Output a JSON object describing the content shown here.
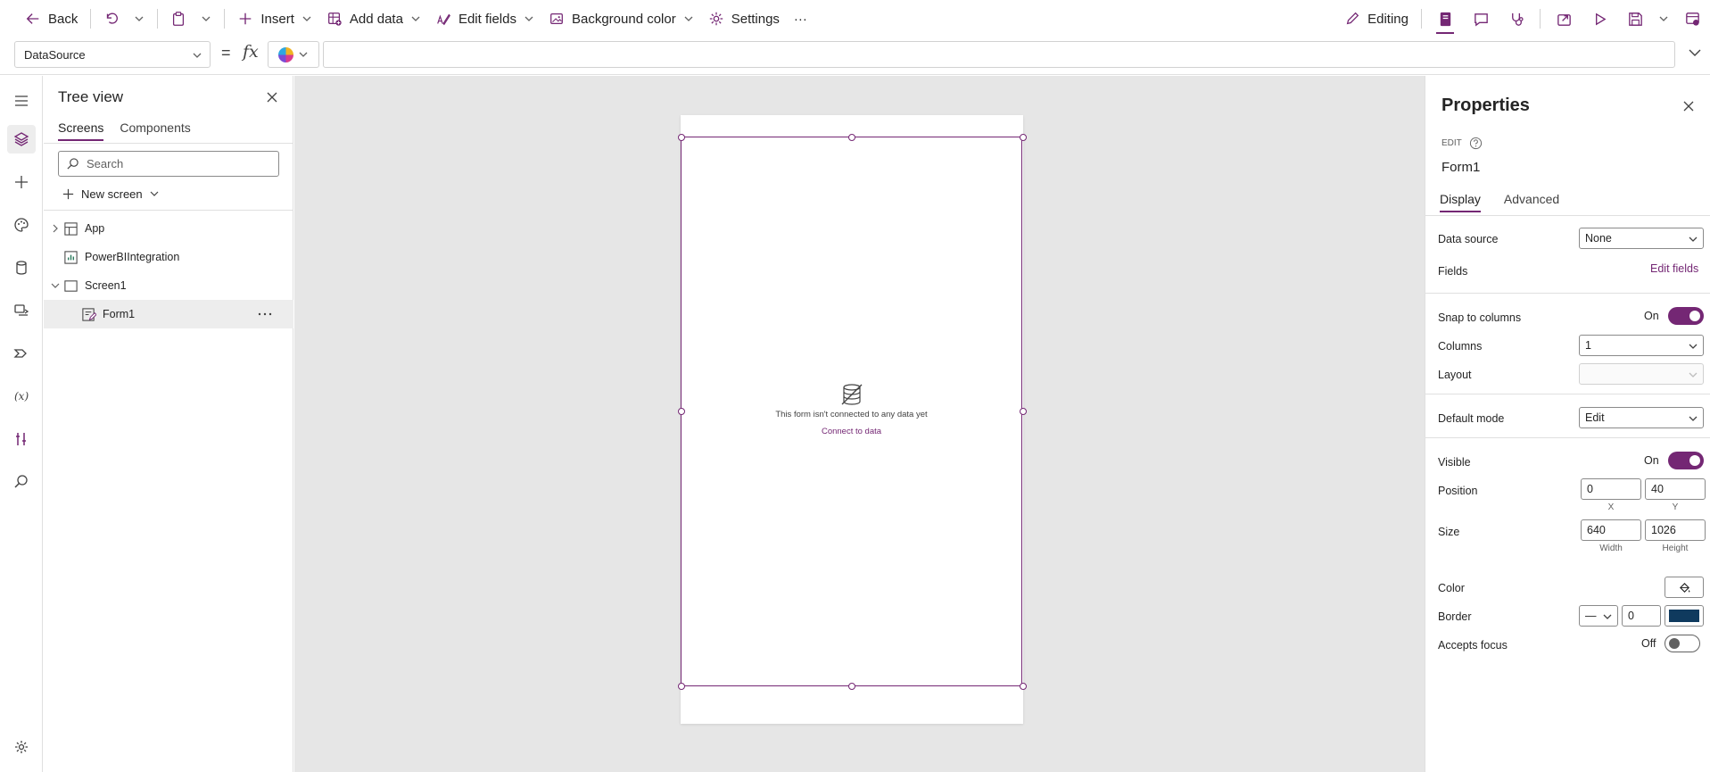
{
  "toolbar": {
    "back": "Back",
    "insert": "Insert",
    "add_data": "Add data",
    "edit_fields": "Edit fields",
    "background_color": "Background color",
    "settings": "Settings",
    "more": "···",
    "editing": "Editing"
  },
  "formula": {
    "property": "DataSource",
    "equals": "=",
    "fx": "fx",
    "value": ""
  },
  "tree": {
    "title": "Tree view",
    "tabs": [
      "Screens",
      "Components"
    ],
    "search_placeholder": "Search",
    "new_screen": "New screen",
    "items": [
      {
        "label": "App",
        "icon": "app-icon"
      },
      {
        "label": "PowerBIIntegration",
        "icon": "powerbi-integration-icon"
      },
      {
        "label": "Screen1",
        "icon": "screen-icon"
      },
      {
        "label": "Form1",
        "icon": "form-icon"
      }
    ]
  },
  "canvas": {
    "message": "This form isn't connected to any data yet",
    "link": "Connect to data"
  },
  "properties": {
    "title": "Properties",
    "edit_label": "EDIT",
    "control_name": "Form1",
    "tabs": [
      "Display",
      "Advanced"
    ],
    "data_source": {
      "label": "Data source",
      "value": "None"
    },
    "fields": {
      "label": "Fields",
      "link": "Edit fields"
    },
    "snap": {
      "label": "Snap to columns",
      "state": "On"
    },
    "columns": {
      "label": "Columns",
      "value": "1"
    },
    "layout": {
      "label": "Layout",
      "value": ""
    },
    "default_mode": {
      "label": "Default mode",
      "value": "Edit"
    },
    "visible": {
      "label": "Visible",
      "state": "On"
    },
    "position": {
      "label": "Position",
      "x": "0",
      "y": "40",
      "x_caption": "X",
      "y_caption": "Y"
    },
    "size": {
      "label": "Size",
      "width": "640",
      "height": "1026",
      "width_caption": "Width",
      "height_caption": "Height"
    },
    "color": {
      "label": "Color"
    },
    "border": {
      "label": "Border",
      "style": "—",
      "thickness": "0",
      "color": "#0f3a5e"
    },
    "accepts_focus": {
      "label": "Accepts focus",
      "state": "Off"
    }
  },
  "colors": {
    "accent": "#742774",
    "canvas": "#e6e6e6"
  }
}
